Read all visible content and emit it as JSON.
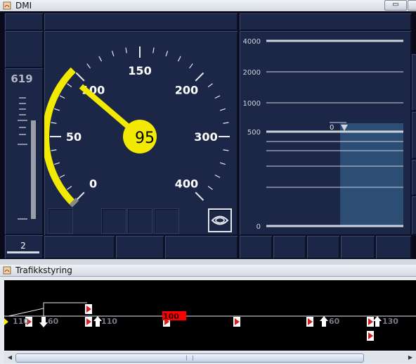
{
  "dmi_window": {
    "title": "DMI",
    "minimize_label": "▭"
  },
  "distance": {
    "value": "619",
    "fill_fraction": 0.619
  },
  "mode": {
    "level": "2"
  },
  "speedometer": {
    "current_speed": "95",
    "current_speed_value": 95,
    "permitted_speed_value": 100,
    "max_scale": 400,
    "scale_labels": [
      "0",
      "50",
      "100",
      "150",
      "200",
      "300",
      "400"
    ]
  },
  "planning": {
    "distance_labels": [
      "4000",
      "2000",
      "1000",
      "500",
      "0"
    ],
    "speed_target_label": "0"
  },
  "traffic_window": {
    "title": "Trafikkstyring"
  },
  "track": {
    "speed_labels": [
      "110",
      "60",
      "110",
      "100",
      "60",
      "130"
    ]
  },
  "colors": {
    "dmi_background": "#1c2647",
    "permitted_speed_arc": "#f2ea00",
    "needle": "#f2ea00",
    "planning_area": "#2c4d74",
    "track_marker_red": "#d81e1e"
  }
}
